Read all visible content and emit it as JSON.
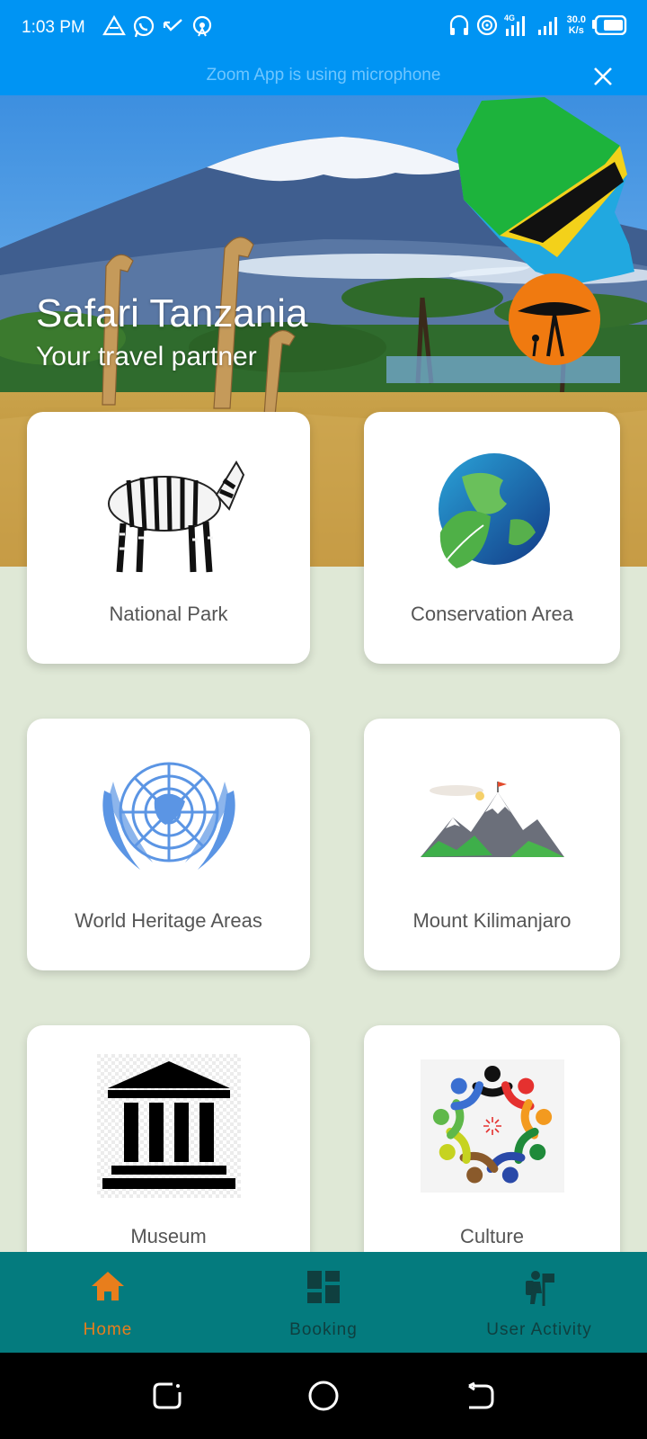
{
  "status_bar": {
    "time": "1:03 PM",
    "network_speed_value": "30.0",
    "network_speed_unit": "K/s",
    "network_type": "4G"
  },
  "banner": {
    "text": "Zoom App is using microphone"
  },
  "hero": {
    "title": "Safari Tanzania",
    "subtitle": "Your travel partner"
  },
  "cards": [
    {
      "label": "National Park",
      "icon": "zebra-icon"
    },
    {
      "label": "Conservation Area",
      "icon": "globe-leaf-icon"
    },
    {
      "label": "World Heritage Areas",
      "icon": "un-emblem-icon"
    },
    {
      "label": "Mount Kilimanjaro",
      "icon": "mountain-icon"
    },
    {
      "label": "Museum",
      "icon": "museum-icon"
    },
    {
      "label": "Culture",
      "icon": "culture-circle-icon"
    }
  ],
  "bottom_nav": {
    "items": [
      {
        "label": "Home",
        "icon": "home-icon",
        "active": true
      },
      {
        "label": "Booking",
        "icon": "dashboard-icon",
        "active": false
      },
      {
        "label": "User Activity",
        "icon": "hiker-icon",
        "active": false
      }
    ],
    "active_color": "#e87e1c",
    "inactive_color": "#0f3f3f",
    "background": "#047b7e"
  },
  "colors": {
    "status_bar": "#0094f3",
    "page_background": "#dfe8d6"
  }
}
